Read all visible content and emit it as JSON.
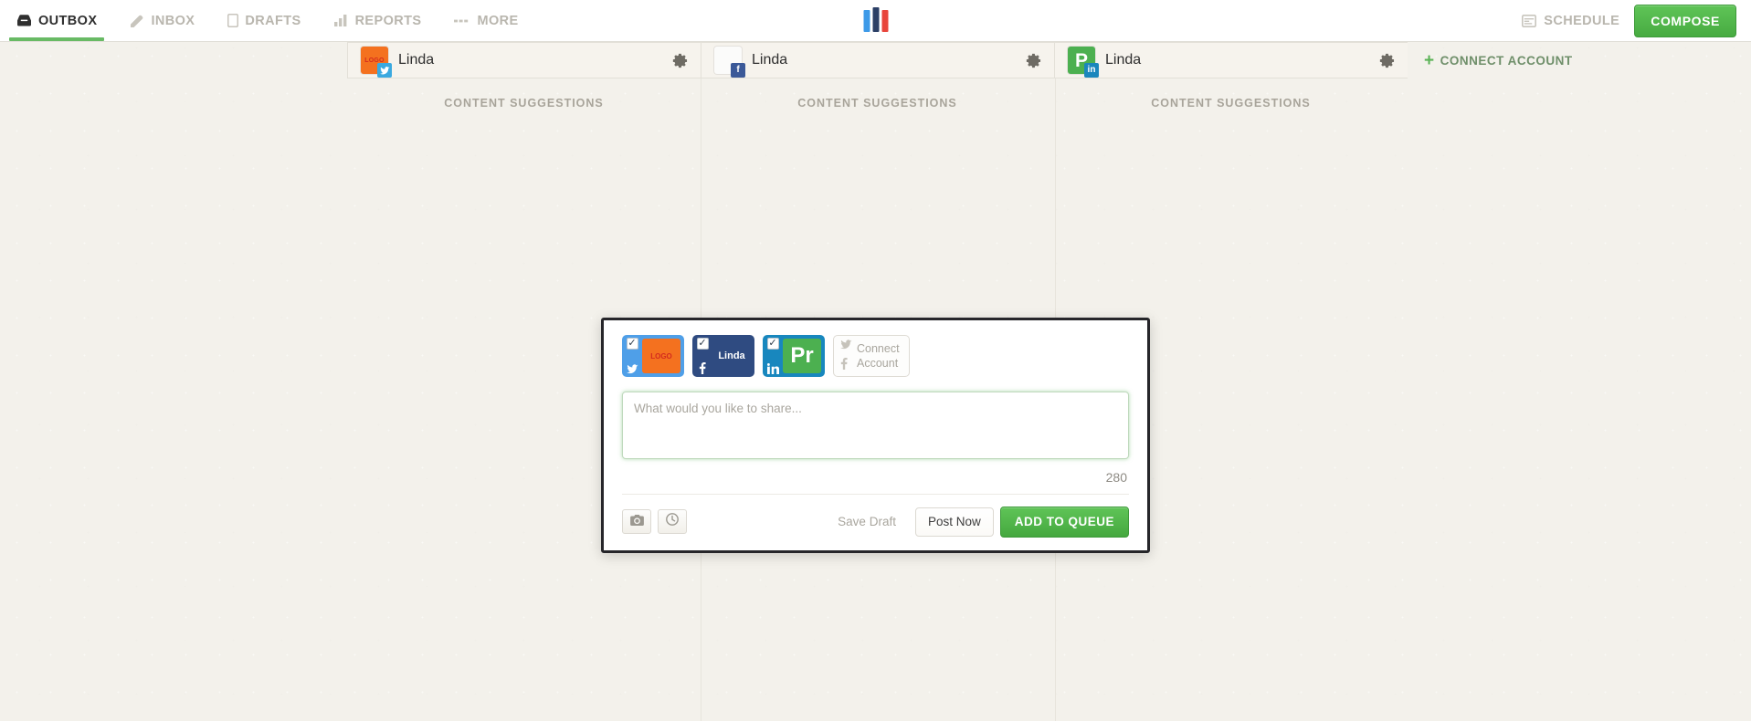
{
  "nav": {
    "items": [
      {
        "label": "OUTBOX",
        "icon": "outbox-icon",
        "active": true
      },
      {
        "label": "INBOX",
        "icon": "inbox-icon",
        "active": false
      },
      {
        "label": "DRAFTS",
        "icon": "drafts-icon",
        "active": false
      },
      {
        "label": "REPORTS",
        "icon": "reports-icon",
        "active": false
      },
      {
        "label": "MORE",
        "icon": "more-icon",
        "active": false
      }
    ],
    "logo": {
      "name": "brand-logo",
      "bars": [
        "#3d9ae8",
        "#2b3f66",
        "#e8453c"
      ]
    },
    "schedule_label": "SCHEDULE",
    "compose_label": "COMPOSE"
  },
  "columns": {
    "subtitle": "CONTENT SUGGESTIONS",
    "accounts": [
      {
        "name": "Linda",
        "network": "twitter",
        "avatar_type": "logo",
        "avatar_text": "LOGO",
        "avatar_color": "#f4711f",
        "badge": "twitter-badge"
      },
      {
        "name": "Linda",
        "network": "facebook",
        "avatar_type": "blank",
        "avatar_text": "",
        "avatar_color": "#fbfbfa",
        "badge": "facebook-badge"
      },
      {
        "name": "Linda",
        "network": "linkedin",
        "avatar_type": "letter",
        "avatar_text": "P",
        "avatar_color": "#4cb050",
        "badge": "linkedin-badge"
      }
    ],
    "connect_account_label": "CONNECT ACCOUNT"
  },
  "compose": {
    "chips": [
      {
        "network": "twitter",
        "checked": "✓",
        "label": "LOGO",
        "style": "orange"
      },
      {
        "network": "facebook",
        "checked": "✓",
        "label": "Linda",
        "style": "navy"
      },
      {
        "network": "linkedin",
        "checked": "✓",
        "label": "Pr",
        "style": "green"
      }
    ],
    "connect": {
      "line1": "Connect",
      "line2": "Account"
    },
    "placeholder": "What would you like to share...",
    "value": "",
    "char_count": "280",
    "buttons": {
      "save_draft": "Save Draft",
      "post_now": "Post Now",
      "add_to_queue": "ADD TO QUEUE"
    },
    "tools": [
      {
        "name": "attach-photo-button",
        "icon": "camera-icon"
      },
      {
        "name": "schedule-time-button",
        "icon": "clock-icon"
      }
    ]
  },
  "colors": {
    "accent_green": "#53ba4c",
    "page_bg": "#f3f1eb",
    "modal_border": "#26262a"
  }
}
